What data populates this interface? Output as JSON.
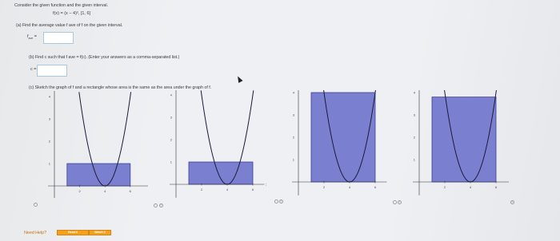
{
  "problem": {
    "intro": "Consider the given function and the given interval.",
    "function": "f(x) = (x − 4)²,   [1, 6]"
  },
  "part_a": {
    "text": "(a)  Find the average value f",
    "text_tail": "ave of f on the given interval.",
    "answer_label": "f",
    "answer_sub": "ave",
    "answer_eq": " ="
  },
  "part_b": {
    "text": "(b)  Find c such that f",
    "text_mid": "ave = f(c). (Enter your answers as a comma-separated list.)",
    "answer_label": "c ="
  },
  "part_c": {
    "text": "(c)  Sketch the graph of f and a rectangle whose area is the same as the area under the graph of f."
  },
  "graphs": [
    {
      "id": 1,
      "rect_height": 1.0,
      "y_ticks": [
        "4",
        "3",
        "2",
        "1",
        "-1"
      ],
      "x_ticks": [
        "2",
        "4",
        "6"
      ]
    },
    {
      "id": 2,
      "rect_height": 1.0,
      "y_ticks": [
        "4",
        "3",
        "2",
        "1",
        "-1"
      ],
      "x_ticks": [
        "2",
        "4",
        "6"
      ]
    },
    {
      "id": 3,
      "rect_height": 4.0,
      "y_ticks": [
        "4",
        "3",
        "2",
        "1",
        "-1"
      ],
      "x_ticks": [
        "2",
        "4",
        "6"
      ]
    },
    {
      "id": 4,
      "rect_height": 3.8,
      "y_ticks": [
        "4",
        "3",
        "2",
        "1",
        "-1"
      ],
      "x_ticks": [
        "2",
        "4",
        "6"
      ]
    }
  ],
  "axis_labels": {
    "x": "x",
    "y": "y"
  },
  "colors": {
    "rect_fill": "#7b7fcf",
    "rect_stroke": "#3b3f9a",
    "curve": "#1b1b3a",
    "accent": "#f6a11a"
  },
  "footer": {
    "need_help": "Need Help?",
    "read_it": "Read It",
    "watch_it": "Watch It"
  }
}
